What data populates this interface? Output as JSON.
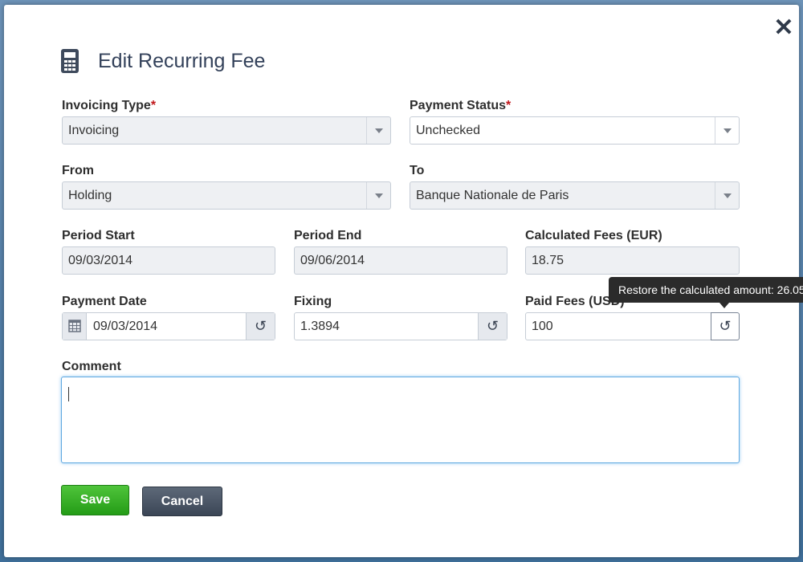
{
  "dialog": {
    "title": "Edit Recurring Fee",
    "close_icon": "close-icon",
    "title_icon": "calculator-icon"
  },
  "fields": {
    "invoicing_type": {
      "label": "Invoicing Type",
      "required_mark": "*",
      "value": "Invoicing"
    },
    "payment_status": {
      "label": "Payment Status",
      "required_mark": "*",
      "value": "Unchecked"
    },
    "from": {
      "label": "From",
      "value": "Holding"
    },
    "to": {
      "label": "To",
      "value": "Banque Nationale de Paris"
    },
    "period_start": {
      "label": "Period Start",
      "value": "09/03/2014"
    },
    "period_end": {
      "label": "Period End",
      "value": "09/06/2014"
    },
    "calculated_fees": {
      "label": "Calculated Fees (EUR)",
      "value": "18.75"
    },
    "payment_date": {
      "label": "Payment Date",
      "value": "09/03/2014"
    },
    "fixing": {
      "label": "Fixing",
      "value": "1.3894"
    },
    "paid_fees": {
      "label": "Paid Fees (USD)",
      "value": "100"
    },
    "comment": {
      "label": "Comment",
      "value": ""
    }
  },
  "tooltip": {
    "text": "Restore the calculated amount: 26.05"
  },
  "buttons": {
    "save": "Save",
    "cancel": "Cancel"
  },
  "colors": {
    "save": "#2fa81f",
    "cancel": "#4a5565",
    "required": "#c0161a",
    "focus": "#5fa8e0"
  }
}
